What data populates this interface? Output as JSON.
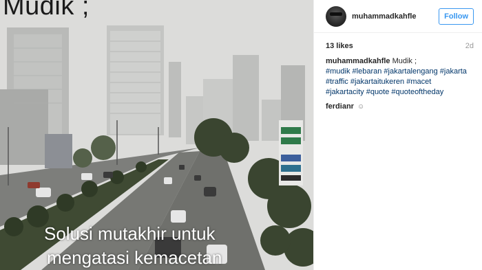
{
  "photo": {
    "overlay_title": "Mudik ;",
    "caption_line1": "Solusi mutakhir untuk",
    "caption_line2": "mengatasi kemacetan"
  },
  "post": {
    "username": "muhammadkahfle",
    "follow_label": "Follow",
    "likes": "13 likes",
    "age": "2d",
    "caption_user": "muhammadkahfle",
    "caption_text": "Mudik ;",
    "hashtags": [
      "#mudik",
      "#lebaran",
      "#jakartalengang",
      "#jakarta",
      "#traffic",
      "#jakartaitukeren",
      "#macet",
      "#jakartacity",
      "#quote",
      "#quoteoftheday"
    ],
    "second_comment_user": "ferdianr",
    "second_comment_emoji": "smile-emoji"
  },
  "colors": {
    "link_blue": "#3897f0",
    "hashtag": "#003569",
    "text": "#262626",
    "muted": "#999999"
  }
}
